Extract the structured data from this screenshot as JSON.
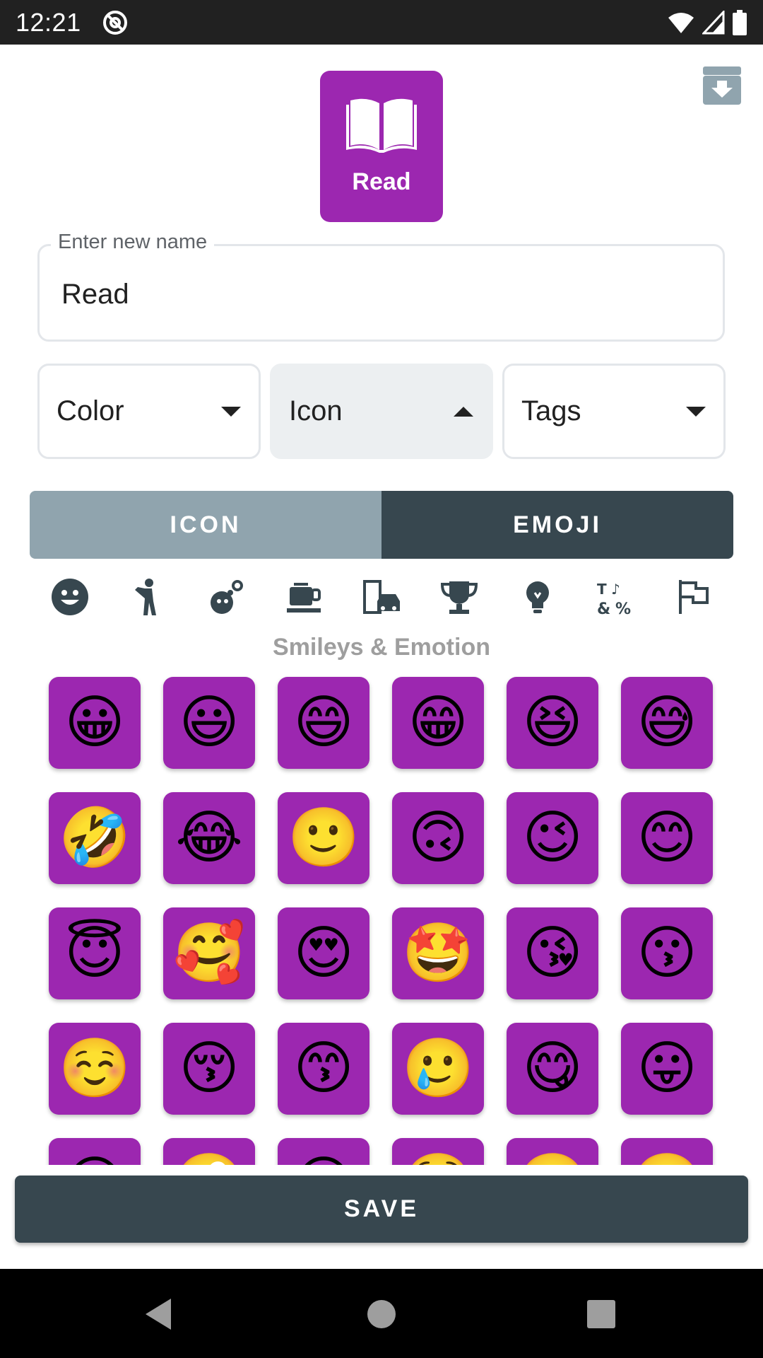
{
  "status_bar": {
    "time": "12:21"
  },
  "preview": {
    "label": "Read",
    "icon": "book-open-icon",
    "color": "#9c27b0"
  },
  "name_field": {
    "legend": "Enter new name",
    "value": "Read"
  },
  "dropdowns": [
    {
      "label": "Color",
      "state": "collapsed"
    },
    {
      "label": "Icon",
      "state": "expanded"
    },
    {
      "label": "Tags",
      "state": "collapsed"
    }
  ],
  "tabs": [
    {
      "label": "ICON",
      "selected": false
    },
    {
      "label": "EMOJI",
      "selected": true
    }
  ],
  "categories": [
    "smiley-icon",
    "person-icon",
    "animal-flower-icon",
    "food-drink-icon",
    "travel-places-icon",
    "activities-trophy-icon",
    "objects-lightbulb-icon",
    "symbols-icon",
    "flags-icon"
  ],
  "section_title": "Smileys & Emotion",
  "emojis": [
    "😀",
    "😃",
    "😄",
    "😁",
    "😆",
    "😅",
    "🤣",
    "😂",
    "🙂",
    "🙃",
    "😉",
    "😊",
    "😇",
    "🥰",
    "😍",
    "🤩",
    "😘",
    "😗",
    "☺️",
    "😚",
    "😙",
    "🥲",
    "😋",
    "😛",
    "😜",
    "🤪",
    "😝",
    "🤑",
    "🤗",
    "🤭"
  ],
  "save_label": "SAVE",
  "colors": {
    "accent": "#9c27b0",
    "dark": "#37474f",
    "inactive_tab": "#90a4ae"
  }
}
